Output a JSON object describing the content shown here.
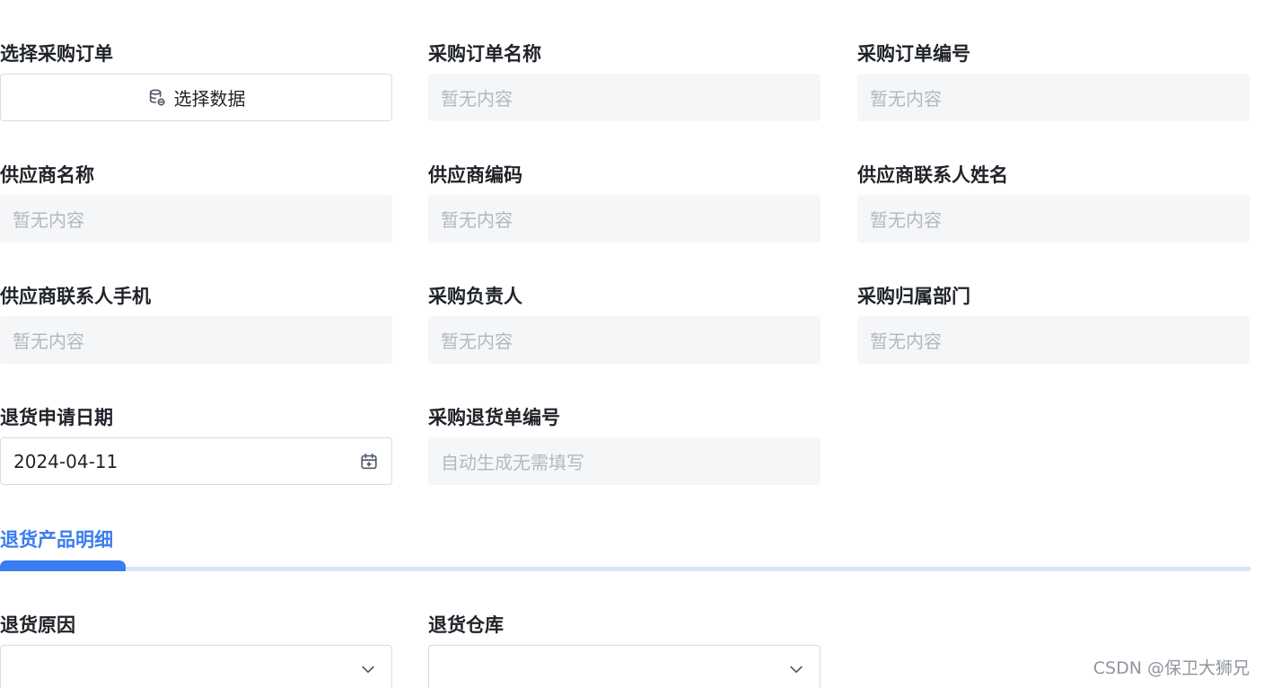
{
  "form": {
    "select_order": {
      "label": "选择采购订单",
      "button_label": "选择数据",
      "button_icon": "database-icon"
    },
    "order_name": {
      "label": "采购订单名称",
      "placeholder": "暂无内容"
    },
    "order_number": {
      "label": "采购订单编号",
      "placeholder": "暂无内容"
    },
    "supplier_name": {
      "label": "供应商名称",
      "placeholder": "暂无内容"
    },
    "supplier_code": {
      "label": "供应商编码",
      "placeholder": "暂无内容"
    },
    "supplier_contact_name": {
      "label": "供应商联系人姓名",
      "placeholder": "暂无内容"
    },
    "supplier_contact_phone": {
      "label": "供应商联系人手机",
      "placeholder": "暂无内容"
    },
    "purchase_owner": {
      "label": "采购负责人",
      "placeholder": "暂无内容"
    },
    "purchase_department": {
      "label": "采购归属部门",
      "placeholder": "暂无内容"
    },
    "return_date": {
      "label": "退货申请日期",
      "value": "2024-04-11",
      "icon": "calendar-icon"
    },
    "return_order_number": {
      "label": "采购退货单编号",
      "placeholder": "自动生成无需填写"
    }
  },
  "section": {
    "title": "退货产品明细",
    "accent_color": "#3a7cf2",
    "track_color": "#d6e5fc"
  },
  "bottom_form": {
    "return_reason": {
      "label": "退货原因",
      "value": "",
      "icon": "chevron-down-icon"
    },
    "return_warehouse": {
      "label": "退货仓库",
      "value": "",
      "icon": "chevron-down-icon"
    }
  },
  "watermark": "CSDN @保卫大狮兄"
}
